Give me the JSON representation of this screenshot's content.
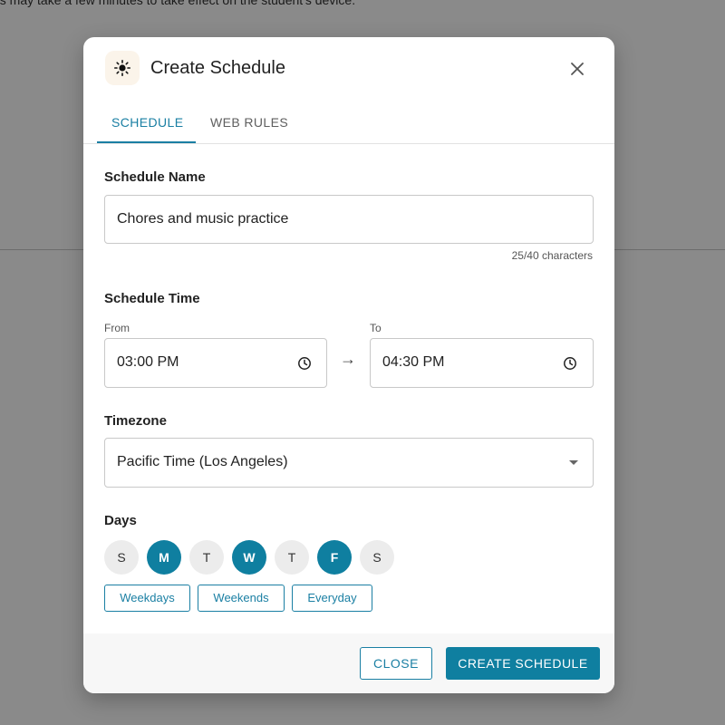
{
  "background": {
    "notice": "es may take a few minutes to take effect on the student's device."
  },
  "dialog": {
    "title": "Create Schedule",
    "icon": "sun-icon",
    "tabs": [
      {
        "label": "SCHEDULE",
        "active": true
      },
      {
        "label": "WEB RULES",
        "active": false
      }
    ],
    "schedule_name": {
      "label": "Schedule Name",
      "value": "Chores and music practice",
      "counter": "25/40 characters"
    },
    "schedule_time": {
      "label": "Schedule Time",
      "from_label": "From",
      "from_value": "03:00 PM",
      "to_label": "To",
      "to_value": "04:30 PM",
      "arrow": "→"
    },
    "timezone": {
      "label": "Timezone",
      "value": "Pacific Time (Los Angeles)"
    },
    "days": {
      "label": "Days",
      "items": [
        {
          "letter": "S",
          "selected": false
        },
        {
          "letter": "M",
          "selected": true
        },
        {
          "letter": "T",
          "selected": false
        },
        {
          "letter": "W",
          "selected": true
        },
        {
          "letter": "T",
          "selected": false
        },
        {
          "letter": "F",
          "selected": true
        },
        {
          "letter": "S",
          "selected": false
        }
      ],
      "presets": [
        "Weekdays",
        "Weekends",
        "Everyday"
      ]
    },
    "buttons": {
      "close": "CLOSE",
      "create": "CREATE SCHEDULE"
    }
  },
  "colors": {
    "accent": "#0f7fa0",
    "tab_active": "#1a7fa3",
    "overlay": "#8a8a8a"
  }
}
